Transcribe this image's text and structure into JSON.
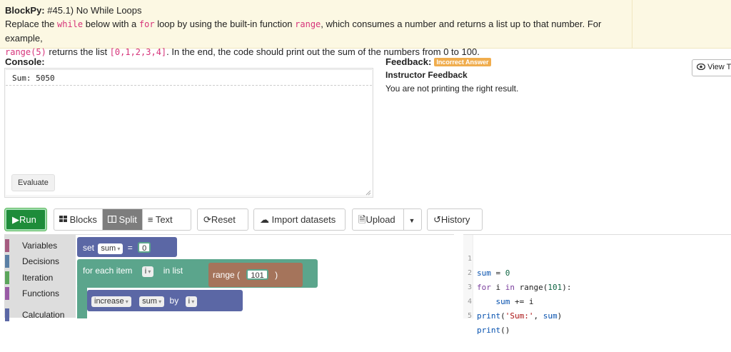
{
  "instructions": {
    "title_prefix": "BlockPy:",
    "title": "#45.1) No While Loops",
    "p1_a": "Replace the ",
    "p1_code1": "while",
    "p1_b": " below with a ",
    "p1_code2": "for",
    "p1_c": " loop by using the built-in function ",
    "p1_code3": "range",
    "p1_d": ", which consumes a number and returns a list up to that number. For example,",
    "p2_code1": "range(5)",
    "p2_a": " returns the list ",
    "p2_code2": "[0,1,2,3,4]",
    "p2_b": ". In the end, the code should print out the sum of the numbers from 0 to 100."
  },
  "console": {
    "label": "Console:",
    "output": "Sum:  5050",
    "evaluate_label": "Evaluate"
  },
  "feedback": {
    "label": "Feedback:",
    "badge": "Incorrect Answer",
    "instructor_title": "Instructor Feedback",
    "message": "You are not printing the right result.",
    "view_label": "View T"
  },
  "toolbar": {
    "run": "Run",
    "blocks": "Blocks",
    "split": "Split",
    "text": "Text",
    "reset": "Reset",
    "import": "Import datasets",
    "upload": "Upload",
    "history": "History"
  },
  "toolbox": [
    {
      "label": "Variables",
      "color": "#a55b80"
    },
    {
      "label": "Decisions",
      "color": "#5b80a5"
    },
    {
      "label": "Iteration",
      "color": "#5ba55b"
    },
    {
      "label": "Functions",
      "color": "#995ba5"
    },
    {
      "label": "Calculation",
      "color": "#5b67a5"
    }
  ],
  "blocks": {
    "set_label": "set",
    "set_var": "sum",
    "set_eq": "=",
    "set_val": "0",
    "for_label": "for each item",
    "for_var": "i",
    "in_list": "in list",
    "range_label": "range (",
    "range_val": "101",
    "range_close": ")",
    "increase_label": "increase",
    "increase_var": "sum",
    "by_label": "by",
    "by_var": "i"
  },
  "editor": {
    "lines": [
      {
        "n": "1",
        "text": "sum = 0"
      },
      {
        "n": "2",
        "text": "for i in range(101):"
      },
      {
        "n": "3",
        "text": "    sum += i"
      },
      {
        "n": "4",
        "text": "print('Sum:', sum)"
      },
      {
        "n": "5",
        "text": "print()"
      }
    ]
  },
  "colors": {
    "run": "#1e8c3a",
    "badge": "#f0ad4e",
    "variables_block": "#5b67a5",
    "loop_block": "#5ba58c",
    "list_block": "#a5745b"
  }
}
